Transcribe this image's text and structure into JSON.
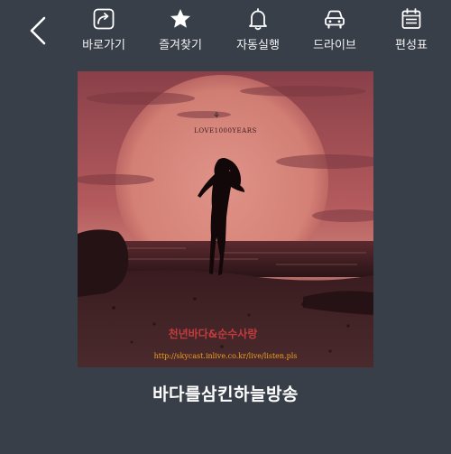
{
  "toolbar": {
    "items": [
      {
        "label": "바로가기",
        "icon": "shortcut-icon"
      },
      {
        "label": "즐겨찾기",
        "icon": "star-icon"
      },
      {
        "label": "자동실행",
        "icon": "bell-icon"
      },
      {
        "label": "드라이브",
        "icon": "car-icon"
      },
      {
        "label": "편성표",
        "icon": "schedule-icon"
      }
    ]
  },
  "artwork": {
    "logo_text": "LOVE1000YEARS",
    "caption": "천년바다&순수사랑",
    "url": "http://skycast.inlive.co.kr/live/listen.pls"
  },
  "station": {
    "name": "바다를삼킨하늘방송"
  },
  "colors": {
    "background": "#393f49",
    "icon": "#ffffff",
    "art_sky": "#b45a5e",
    "caption": "#c03c3c",
    "url_text": "#f0a020"
  }
}
